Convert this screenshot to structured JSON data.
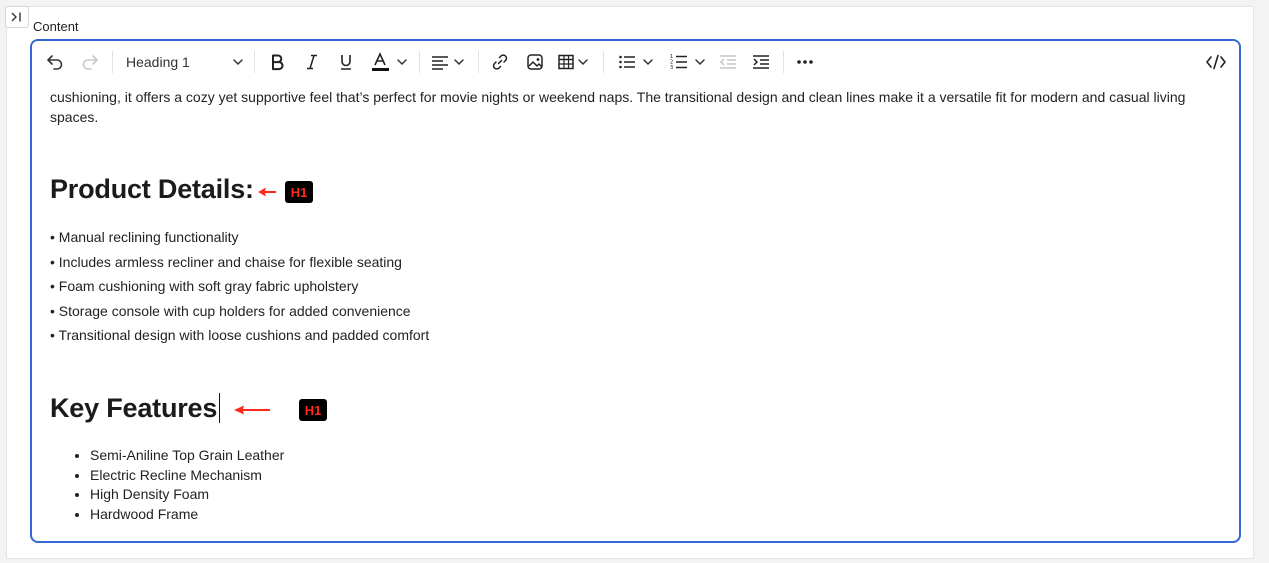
{
  "field": {
    "label": "Content"
  },
  "toolbar": {
    "block_format": "Heading 1"
  },
  "content": {
    "intro_text": "cushioning, it offers a cozy yet supportive feel that’s perfect for movie nights or weekend naps. The transitional design and clean lines make it a versatile fit for modern and casual living spaces.",
    "product_details": {
      "heading": "Product Details:",
      "items": [
        "• Manual reclining functionality",
        "• Includes armless recliner and chaise for flexible seating",
        "• Foam cushioning with soft gray fabric upholstery",
        "• Storage console with cup holders for added convenience",
        "• Transitional design with loose cushions and padded comfort"
      ]
    },
    "key_features": {
      "heading": "Key Features",
      "items": [
        "Semi-Aniline Top Grain Leather",
        "Electric Recline Mechanism",
        "High Density Foam",
        "Hardwood Frame"
      ]
    }
  },
  "annotations": {
    "badge_1": "H1",
    "badge_2": "H1"
  },
  "colors": {
    "editor_border": "#3168d5",
    "annotation_red": "#ff2a1a",
    "badge_bg": "#000000"
  }
}
